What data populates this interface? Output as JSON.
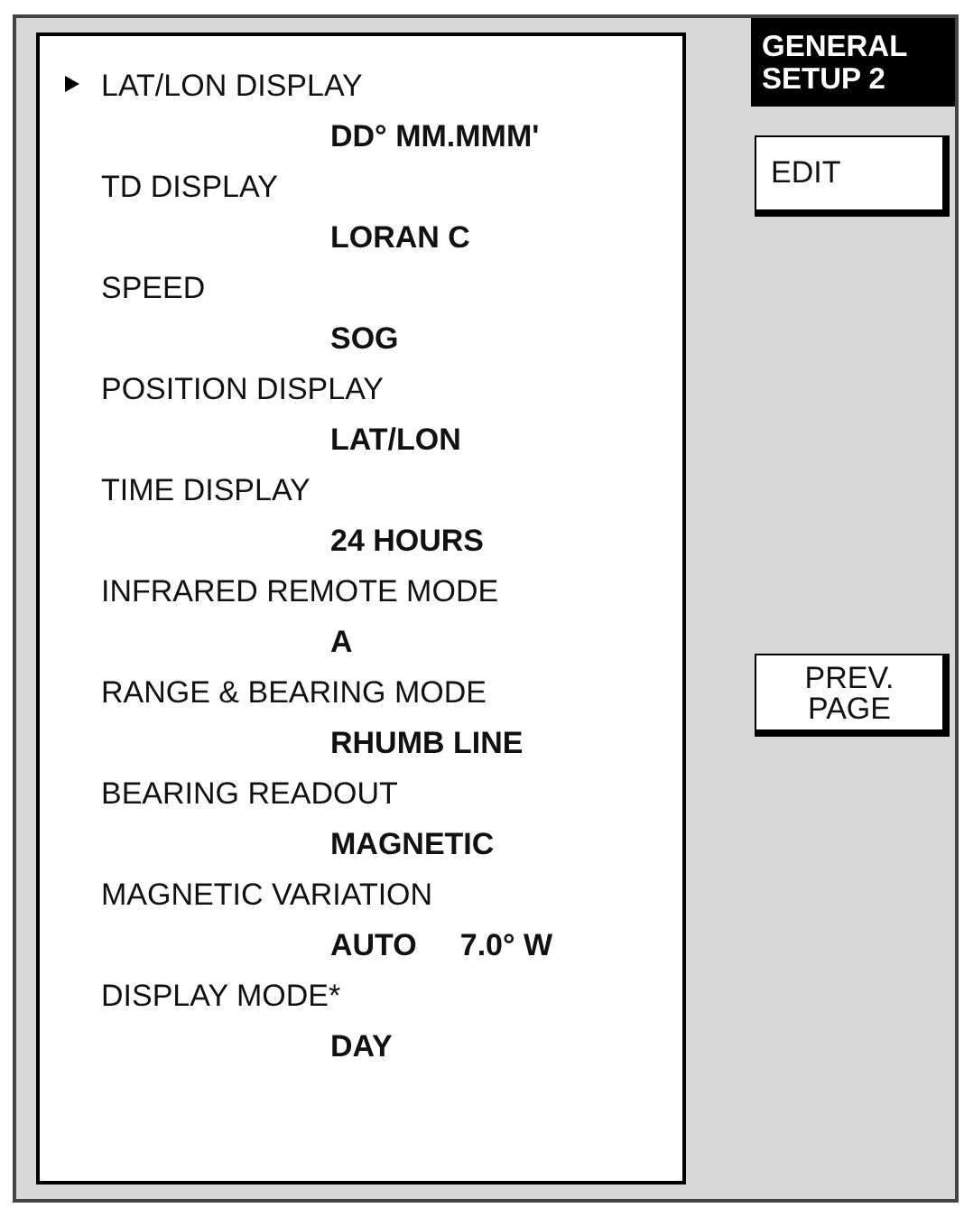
{
  "menu_items": [
    {
      "label": "LAT/LON DISPLAY",
      "values": [
        "DD° MM.MMM'"
      ],
      "selected": true
    },
    {
      "label": "TD DISPLAY",
      "values": [
        "LORAN C"
      ],
      "selected": false
    },
    {
      "label": "SPEED",
      "values": [
        "SOG"
      ],
      "selected": false
    },
    {
      "label": "POSITION DISPLAY",
      "values": [
        "LAT/LON"
      ],
      "selected": false
    },
    {
      "label": "TIME DISPLAY",
      "values": [
        "24 HOURS"
      ],
      "selected": false
    },
    {
      "label": "INFRARED REMOTE MODE",
      "values": [
        "A"
      ],
      "selected": false
    },
    {
      "label": "RANGE & BEARING MODE",
      "values": [
        "RHUMB LINE"
      ],
      "selected": false
    },
    {
      "label": "BEARING READOUT",
      "values": [
        "MAGNETIC"
      ],
      "selected": false
    },
    {
      "label": "MAGNETIC VARIATION",
      "values": [
        "AUTO",
        "7.0° W"
      ],
      "selected": false
    },
    {
      "label": "DISPLAY MODE*",
      "values": [
        "DAY"
      ],
      "selected": false
    }
  ],
  "softkeys": {
    "title": "GENERAL\nSETUP 2",
    "buttons": [
      {
        "label": "EDIT",
        "kind": "single"
      },
      {
        "label": "PREV.\nPAGE",
        "kind": "double"
      }
    ]
  }
}
